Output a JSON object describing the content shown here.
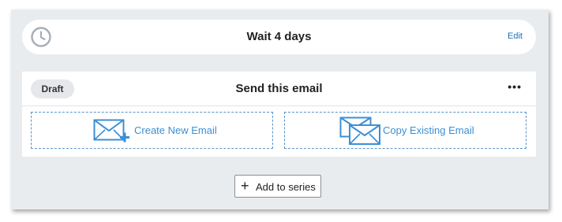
{
  "wait_step": {
    "icon": "clock-icon",
    "title": "Wait 4 days",
    "edit_label": "Edit"
  },
  "email_step": {
    "status": "Draft",
    "title": "Send this email",
    "menu_label": "•••",
    "options": [
      {
        "label": "Create New Email",
        "icon": "envelope-plus-icon"
      },
      {
        "label": "Copy Existing Email",
        "icon": "envelope-copy-icon"
      }
    ]
  },
  "add_button": {
    "icon": "plus-icon",
    "label": "Add to series"
  },
  "colors": {
    "panel_bg": "#e9ecef",
    "accent": "#3b8fd6",
    "link": "#1f6fb5"
  }
}
